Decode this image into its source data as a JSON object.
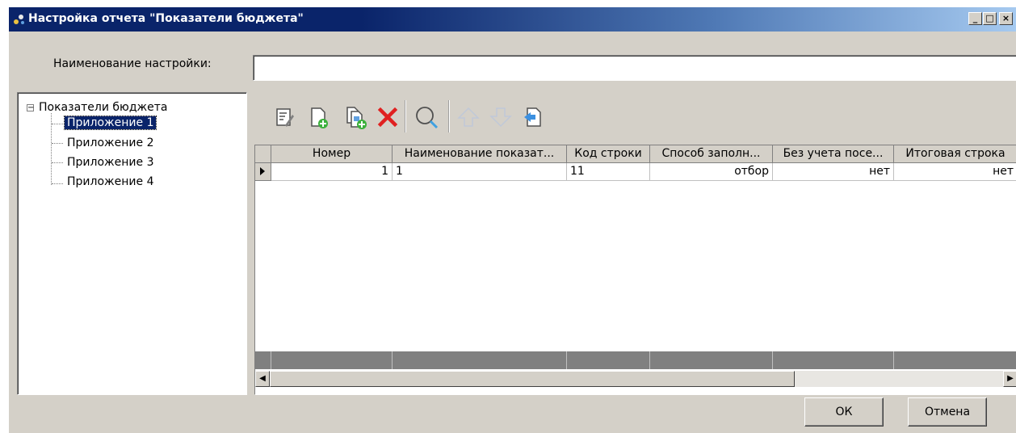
{
  "window": {
    "title": "Настройка отчета \"Показатели бюджета\"",
    "controls": {
      "minimize": "_",
      "maximize": "□",
      "close": "×"
    }
  },
  "form": {
    "name_label": "Наименование настройки:",
    "name_value": ""
  },
  "tree": {
    "root": "Показатели бюджета",
    "expander": "−",
    "items": [
      {
        "label": "Приложение 1",
        "selected": true
      },
      {
        "label": "Приложение 2",
        "selected": false
      },
      {
        "label": "Приложение 3",
        "selected": false
      },
      {
        "label": "Приложение 4",
        "selected": false
      }
    ]
  },
  "toolbar": {
    "icons": [
      "edit-icon",
      "add-icon",
      "copy-add-icon",
      "delete-icon",
      "search-icon",
      "move-up-icon",
      "move-down-icon",
      "import-icon"
    ]
  },
  "table": {
    "columns": [
      "Номер",
      "Наименование показат...",
      "Код строки",
      "Способ заполн...",
      "Без учета посе...",
      "Итоговая строка"
    ],
    "rows": [
      [
        "1",
        "1",
        "11",
        "отбор",
        "нет",
        "нет"
      ]
    ]
  },
  "buttons": {
    "ok": "ОК",
    "cancel": "Отмена"
  },
  "colors": {
    "titlebar": "#0a246a",
    "face": "#d4d0c8",
    "selection": "#0a246a",
    "delete": "#e02020"
  }
}
